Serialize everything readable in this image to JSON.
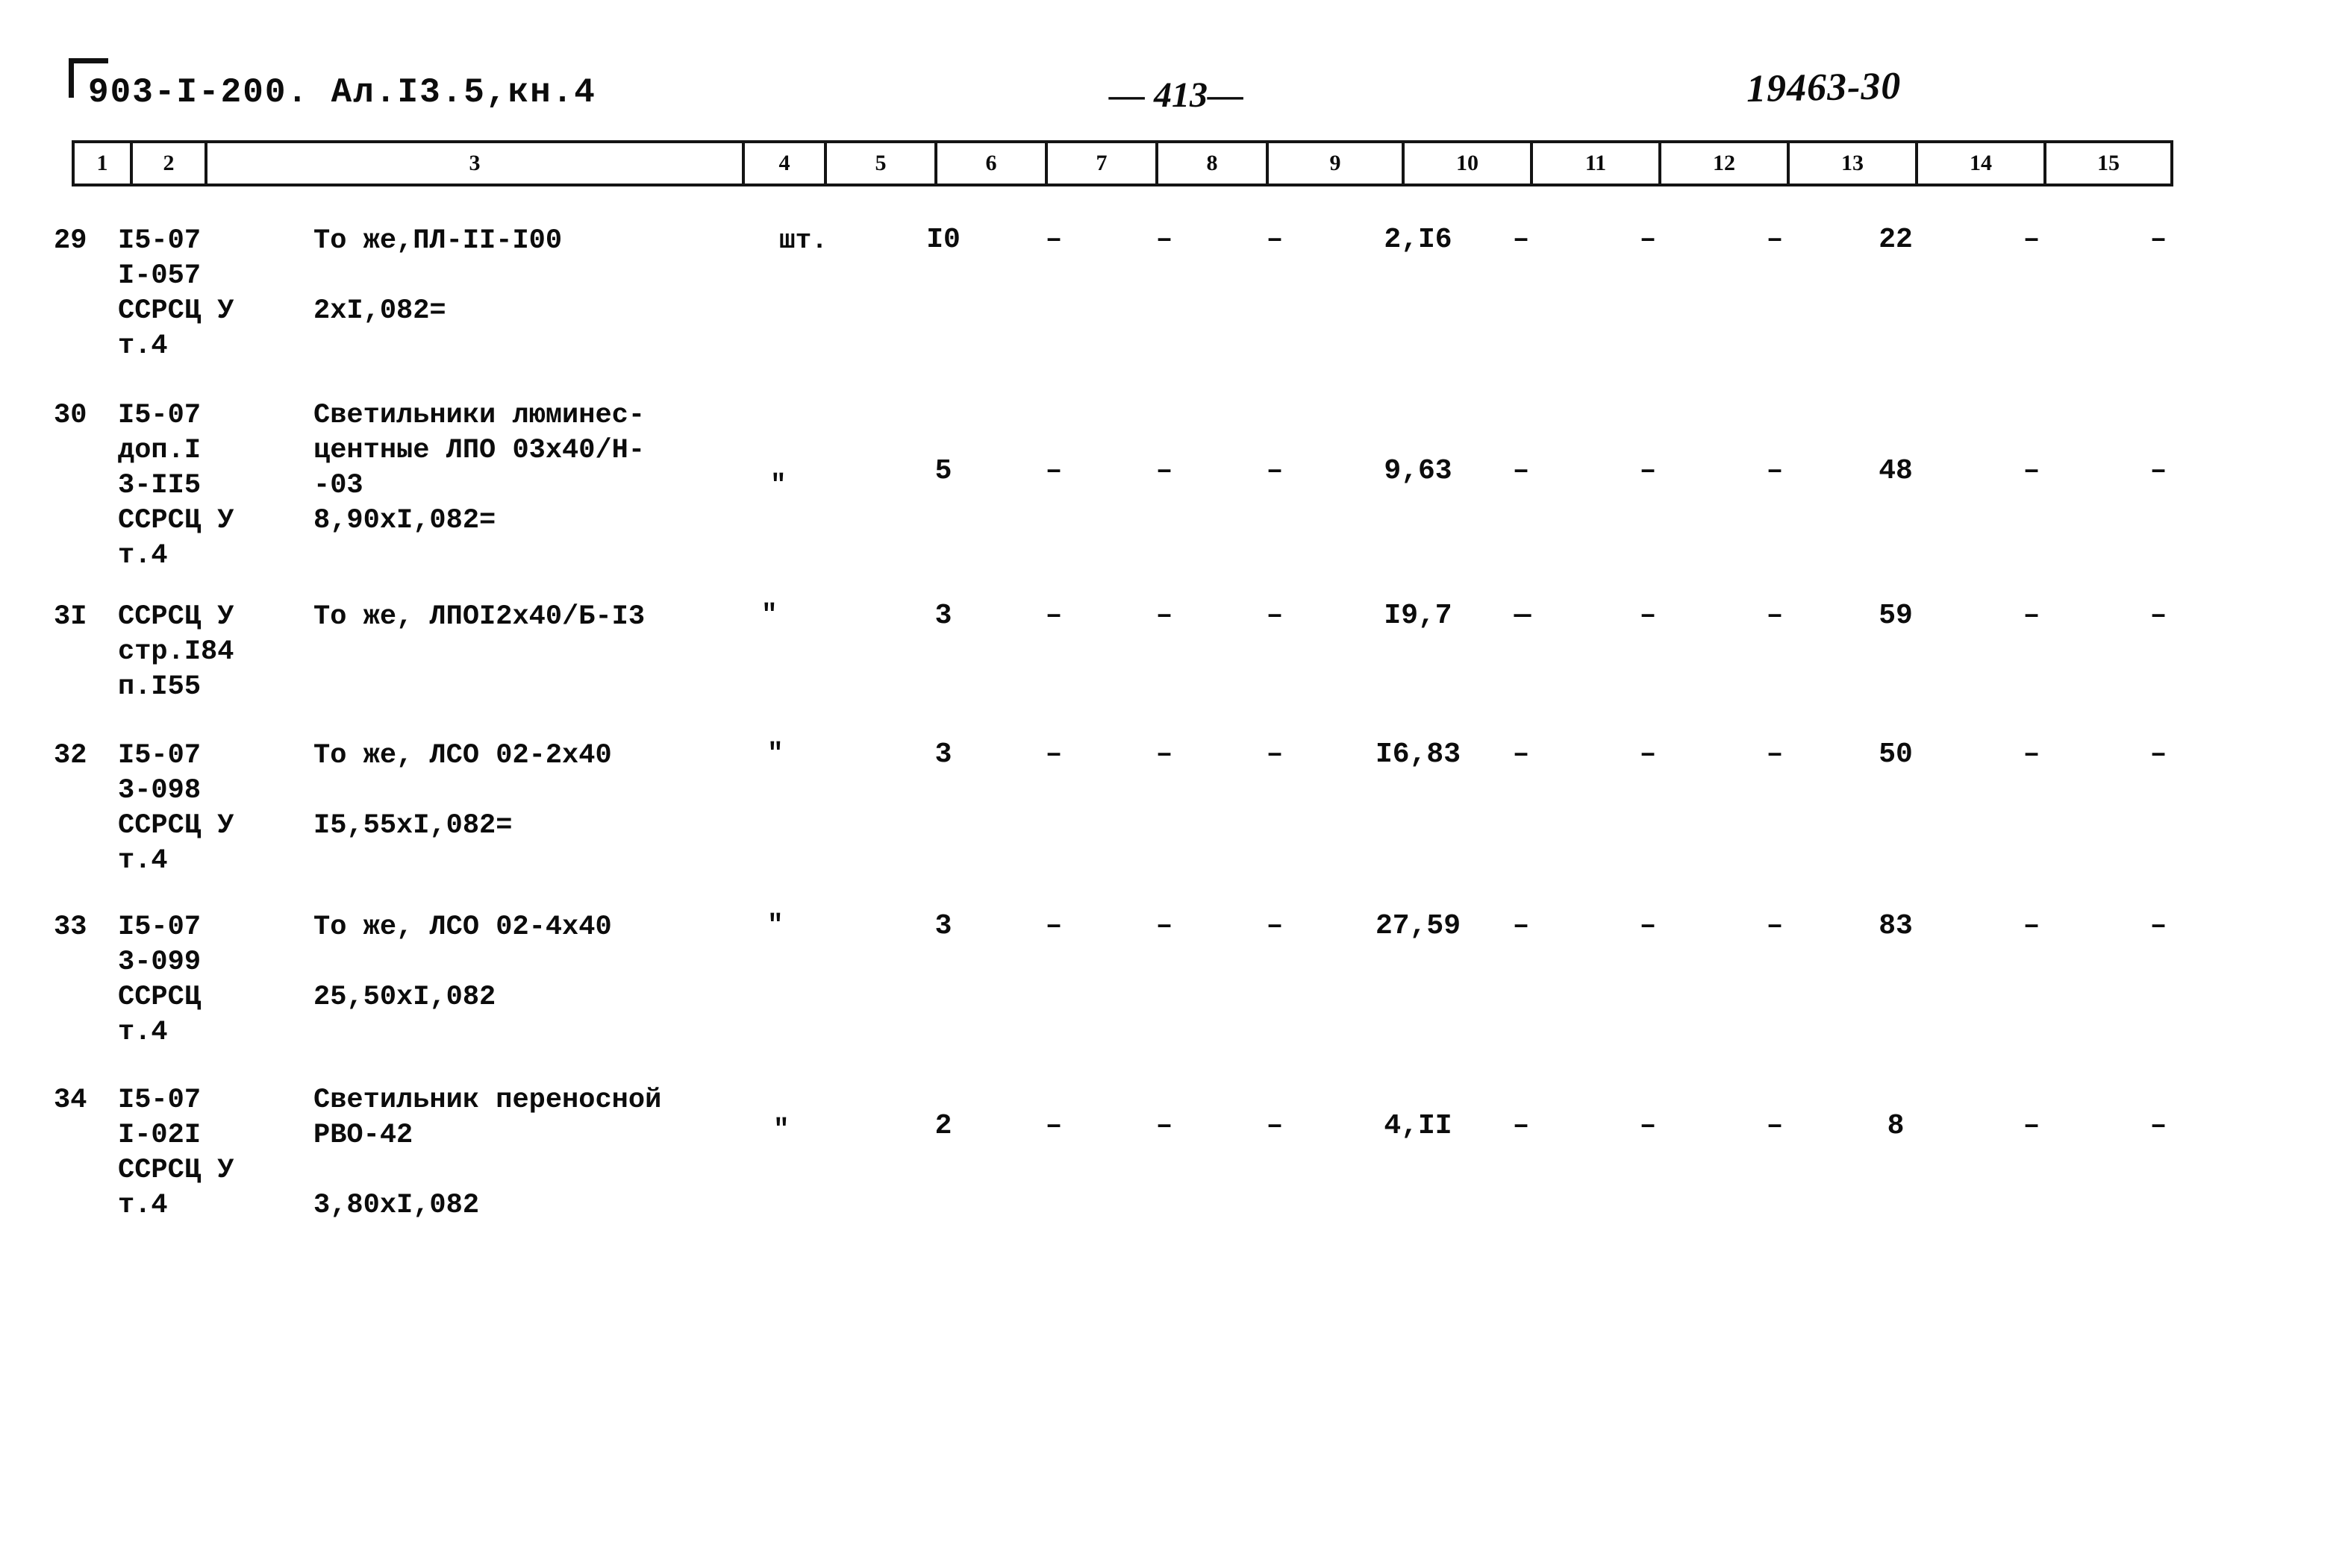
{
  "header": {
    "document_code": "903-I-200. Ал.I3.5,кн.4",
    "page_number": "— 413—",
    "archive_code": "19463-30"
  },
  "table": {
    "column_numbers": [
      "1",
      "2",
      "3",
      "4",
      "5",
      "6",
      "7",
      "8",
      "9",
      "10",
      "11",
      "12",
      "13",
      "14",
      "15"
    ],
    "rows": [
      {
        "no": "29",
        "code_lines": "I5-07\nI-057\nССРСЦ У\nт.4",
        "description_lines": "То же,ПЛ-II-I00",
        "calc_line": "2xI,082=",
        "unit": "шт.",
        "c5": "I0",
        "c6": "–",
        "c7": "–",
        "c8": "–",
        "c9": "2,I6",
        "c10": "–",
        "c11": "–",
        "c12": "–",
        "c13": "22",
        "c14": "–",
        "c15": "–"
      },
      {
        "no": "30",
        "code_lines": "I5-07\nдоп.I\n3-II5\nССРСЦ У\nт.4",
        "description_lines": "Светильники люминес-\nцентные ЛПО 03х40/Н-\n-03",
        "calc_line": "8,90xI,082=",
        "unit": "\"",
        "c5": "5",
        "c6": "–",
        "c7": "–",
        "c8": "–",
        "c9": "9,63",
        "c10": "–",
        "c11": "–",
        "c12": "–",
        "c13": "48",
        "c14": "–",
        "c15": "–"
      },
      {
        "no": "3I",
        "code_lines": "ССРСЦ У\nстр.I84\nп.I55",
        "description_lines": "То же, ЛПОI2х40/Б-I3",
        "calc_line": "",
        "unit": "\"",
        "c5": "3",
        "c6": "–",
        "c7": "–",
        "c8": "–",
        "c9": "I9,7",
        "c10": "—",
        "c11": "–",
        "c12": "–",
        "c13": "59",
        "c14": "–",
        "c15": "–"
      },
      {
        "no": "32",
        "code_lines": "I5-07\n3-098\nССРСЦ У\nт.4",
        "description_lines": "То же, ЛСО 02-2х40",
        "calc_line": "I5,55xI,082=",
        "unit": "\"",
        "c5": "3",
        "c6": "–",
        "c7": "–",
        "c8": "–",
        "c9": "I6,83",
        "c10": "–",
        "c11": "–",
        "c12": "–",
        "c13": "50",
        "c14": "–",
        "c15": "–"
      },
      {
        "no": "33",
        "code_lines": "I5-07\n3-099\nССРСЦ\nт.4",
        "description_lines": "То же, ЛСО 02-4х40",
        "calc_line": "25,50xI,082",
        "unit": "\"",
        "c5": "3",
        "c6": "–",
        "c7": "–",
        "c8": "–",
        "c9": "27,59",
        "c10": "–",
        "c11": "–",
        "c12": "–",
        "c13": "83",
        "c14": "–",
        "c15": "–"
      },
      {
        "no": "34",
        "code_lines": "I5-07\nI-02I\nССРСЦ У\nт.4",
        "description_lines": "Светильник переносной\nРВО-42",
        "calc_line": "3,80xI,082",
        "unit": "\"",
        "c5": "2",
        "c6": "–",
        "c7": "–",
        "c8": "–",
        "c9": "4,II",
        "c10": "–",
        "c11": "–",
        "c12": "–",
        "c13": "8",
        "c14": "–",
        "c15": "–"
      }
    ]
  }
}
